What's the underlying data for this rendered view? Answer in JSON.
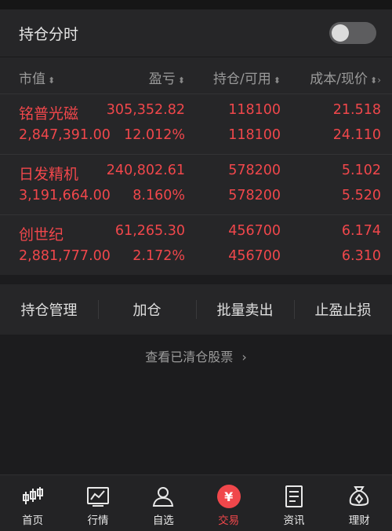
{
  "header": {
    "title": "持仓分时",
    "toggle_on": false
  },
  "columns": {
    "name": "市值",
    "pl": "盈亏",
    "holding": "持仓/可用",
    "cost": "成本/现价"
  },
  "positions": [
    {
      "name": "铭普光磁",
      "market_value": "2,847,391.00",
      "pl": "305,352.82",
      "pl_pct": "12.012%",
      "holding": "118100",
      "available": "118100",
      "cost": "21.518",
      "price": "24.110"
    },
    {
      "name": "日发精机",
      "market_value": "3,191,664.00",
      "pl": "240,802.61",
      "pl_pct": "8.160%",
      "holding": "578200",
      "available": "578200",
      "cost": "5.102",
      "price": "5.520"
    },
    {
      "name": "创世纪",
      "market_value": "2,881,777.00",
      "pl": "61,265.30",
      "pl_pct": "2.172%",
      "holding": "456700",
      "available": "456700",
      "cost": "6.174",
      "price": "6.310"
    }
  ],
  "actions": [
    "持仓管理",
    "加仓",
    "批量卖出",
    "止盈止损"
  ],
  "cleared_link": "查看已清仓股票",
  "tabs": [
    {
      "label": "首页",
      "icon": "candlestick-icon"
    },
    {
      "label": "行情",
      "icon": "trend-chart-icon"
    },
    {
      "label": "自选",
      "icon": "user-icon"
    },
    {
      "label": "交易",
      "icon": "yen-icon"
    },
    {
      "label": "资讯",
      "icon": "document-icon"
    },
    {
      "label": "理财",
      "icon": "money-bag-icon"
    }
  ],
  "colors": {
    "up": "#f0474b",
    "background": "#1c1c1e",
    "panel": "#262628"
  }
}
